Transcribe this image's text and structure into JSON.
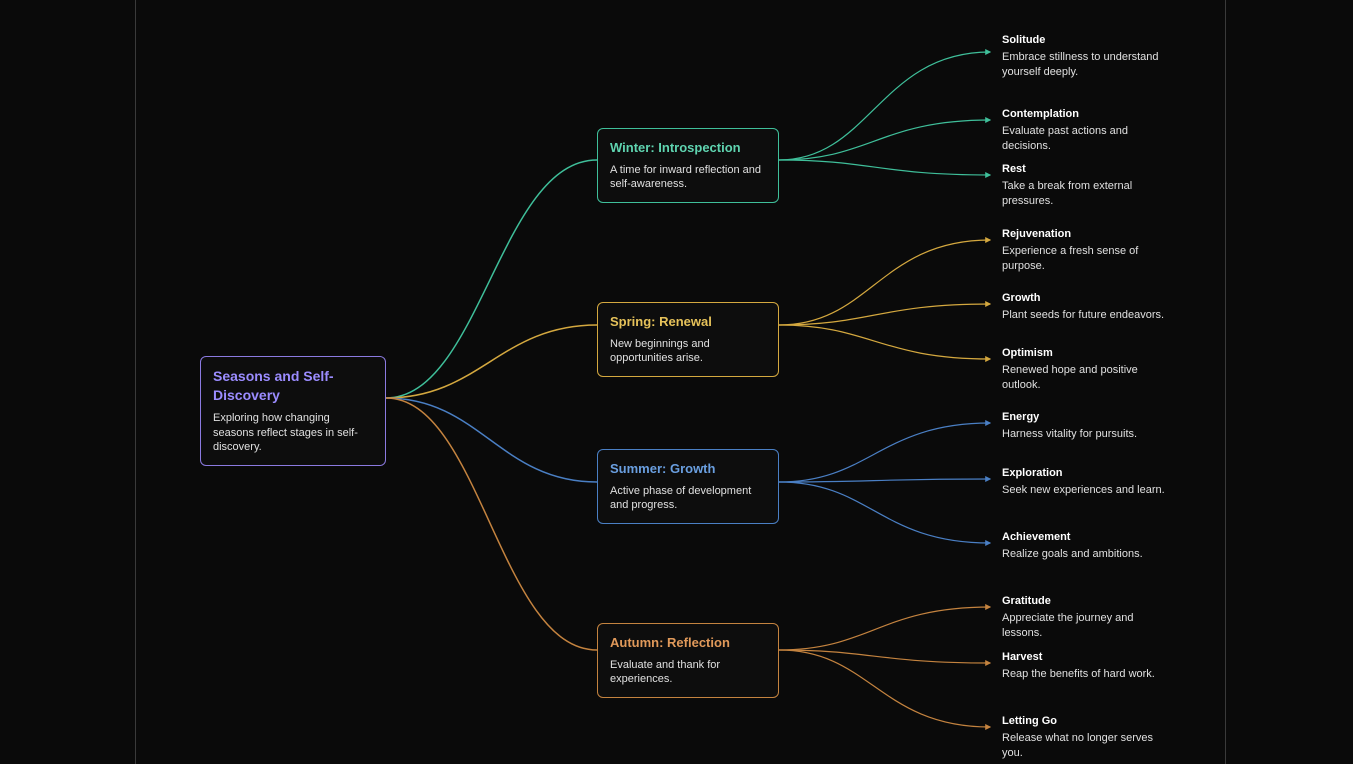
{
  "root": {
    "title": "Seasons and Self-Discovery",
    "desc": "Exploring how changing seasons reflect stages in self-discovery.",
    "color": "#8b7ae0"
  },
  "seasons": [
    {
      "key": "winter",
      "title": "Winter: Introspection",
      "desc": "A time for inward reflection and self-awareness.",
      "color": "#3fbf9a",
      "leaves": [
        {
          "title": "Solitude",
          "desc": "Embrace stillness to understand yourself deeply."
        },
        {
          "title": "Contemplation",
          "desc": "Evaluate past actions and decisions."
        },
        {
          "title": "Rest",
          "desc": "Take a break from external pressures."
        }
      ]
    },
    {
      "key": "spring",
      "title": "Spring: Renewal",
      "desc": "New beginnings and opportunities arise.",
      "color": "#d4a83f",
      "leaves": [
        {
          "title": "Rejuvenation",
          "desc": "Experience a fresh sense of purpose."
        },
        {
          "title": "Growth",
          "desc": "Plant seeds for future endeavors."
        },
        {
          "title": "Optimism",
          "desc": "Renewed hope and positive outlook."
        }
      ]
    },
    {
      "key": "summer",
      "title": "Summer: Growth",
      "desc": "Active phase of development and progress.",
      "color": "#4a7fc4",
      "leaves": [
        {
          "title": "Energy",
          "desc": "Harness vitality for pursuits."
        },
        {
          "title": "Exploration",
          "desc": "Seek new experiences and learn."
        },
        {
          "title": "Achievement",
          "desc": "Realize goals and ambitions."
        }
      ]
    },
    {
      "key": "autumn",
      "title": "Autumn: Reflection",
      "desc": "Evaluate and thank for experiences.",
      "color": "#c4833f",
      "leaves": [
        {
          "title": "Gratitude",
          "desc": "Appreciate the journey and lessons."
        },
        {
          "title": "Harvest",
          "desc": "Reap the benefits of hard work."
        },
        {
          "title": "Letting Go",
          "desc": "Release what no longer serves you."
        }
      ]
    }
  ]
}
